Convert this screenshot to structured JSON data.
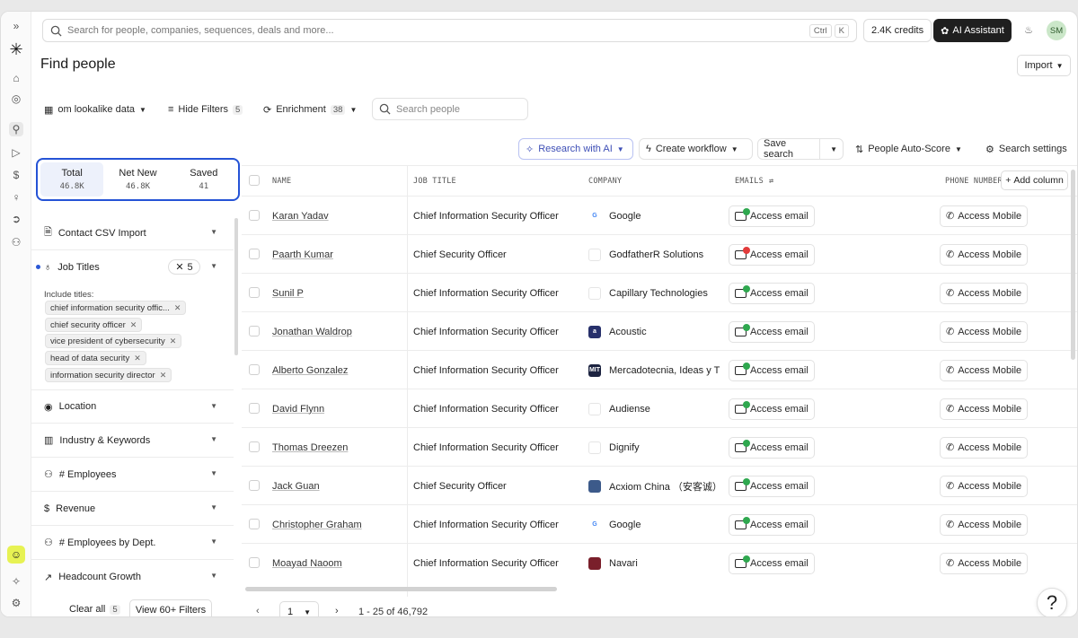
{
  "rail": {
    "expand": "»"
  },
  "topbar": {
    "search_placeholder": "Search for people, companies, sequences, deals and more...",
    "kbd_ctrl": "Ctrl",
    "kbd_k": "K",
    "credits": "2.4K credits",
    "ai_assistant": "AI Assistant",
    "avatar_initials": "SM"
  },
  "page": {
    "title": "Find people",
    "import_label": "Import"
  },
  "toolbar": {
    "lookalike": "om lookalike data",
    "hide_filters": "Hide Filters",
    "hide_filters_count": "5",
    "enrichment": "Enrichment",
    "enrichment_count": "38",
    "search_people_placeholder": "Search people",
    "research_ai": "Research with AI",
    "create_workflow": "Create workflow",
    "save_search": "Save search",
    "auto_score": "People Auto-Score",
    "search_settings": "Search settings"
  },
  "tabs": [
    {
      "label": "Total",
      "count": "46.8K"
    },
    {
      "label": "Net New",
      "count": "46.8K"
    },
    {
      "label": "Saved",
      "count": "41"
    }
  ],
  "filters": {
    "contact_csv": "Contact CSV Import",
    "job_titles": "Job Titles",
    "job_titles_count": "5",
    "include_label": "Include titles:",
    "titles": [
      "chief information security offic...",
      "chief security officer",
      "vice president of cybersecurity",
      "head of data security",
      "information security director"
    ],
    "location": "Location",
    "industry": "Industry & Keywords",
    "employees": "# Employees",
    "revenue": "Revenue",
    "employees_dept": "# Employees by Dept.",
    "headcount": "Headcount Growth",
    "clear_all": "Clear all",
    "clear_all_count": "5",
    "view_more": "View 60+ Filters"
  },
  "table": {
    "headers": {
      "name": "NAME",
      "job_title": "JOB TITLE",
      "company": "COMPANY",
      "emails": "EMAILS",
      "phone": "PHONE NUMBER"
    },
    "add_column": "Add column",
    "access_email": "Access email",
    "access_mobile": "Access Mobile",
    "rows": [
      {
        "name": "Karan Yadav",
        "title": "Chief Information Security Officer",
        "company": "Google",
        "logo": "G",
        "logo_color": "#ffffff",
        "email_status": "#2fa84f"
      },
      {
        "name": "Paarth Kumar",
        "title": "Chief Security Officer",
        "company": "GodfatherR Solutions",
        "logo": "",
        "logo_color": "#ffffff",
        "email_status": "#e23b3b"
      },
      {
        "name": "Sunil P",
        "title": "Chief Information Security Officer",
        "company": "Capillary Technologies",
        "logo": "",
        "logo_color": "#ffffff",
        "email_status": "#2fa84f"
      },
      {
        "name": "Jonathan Waldrop",
        "title": "Chief Information Security Officer",
        "company": "Acoustic",
        "logo": "a",
        "logo_color": "#27306b",
        "email_status": "#2fa84f"
      },
      {
        "name": "Alberto Gonzalez",
        "title": "Chief Information Security Officer",
        "company": "Mercadotecnia, Ideas y T",
        "logo": "MIT",
        "logo_color": "#1c2340",
        "email_status": "#2fa84f"
      },
      {
        "name": "David Flynn",
        "title": "Chief Information Security Officer",
        "company": "Audiense",
        "logo": "",
        "logo_color": "#ffffff",
        "email_status": "#2fa84f"
      },
      {
        "name": "Thomas Dreezen",
        "title": "Chief Information Security Officer",
        "company": "Dignify",
        "logo": "",
        "logo_color": "#ffffff",
        "email_status": "#2fa84f"
      },
      {
        "name": "Jack Guan",
        "title": "Chief Security Officer",
        "company": "Acxiom China （安客诚）",
        "logo": "",
        "logo_color": "#3c5a8a",
        "email_status": "#2fa84f"
      },
      {
        "name": "Christopher Graham",
        "title": "Chief Information Security Officer",
        "company": "Google",
        "logo": "G",
        "logo_color": "#ffffff",
        "email_status": "#2fa84f"
      },
      {
        "name": "Moayad Naoom",
        "title": "Chief Information Security Officer",
        "company": "Navari",
        "logo": "",
        "logo_color": "#7a1f2b",
        "email_status": "#2fa84f"
      }
    ]
  },
  "pagination": {
    "page": "1",
    "range": "1 - 25 of 46,792"
  },
  "help": "?"
}
